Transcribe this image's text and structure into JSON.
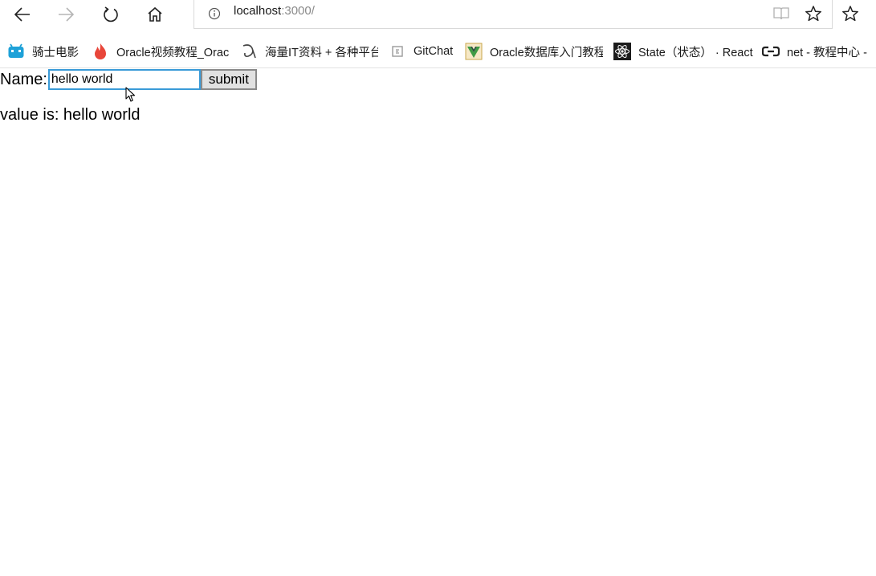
{
  "browser": {
    "address": {
      "host": "localhost",
      "port": ":3000/"
    },
    "toolbar_icons": [
      "back-icon",
      "forward-icon",
      "refresh-icon",
      "home-icon",
      "info-icon",
      "reading-view-icon",
      "favorite-star-icon",
      "favorites-list-icon"
    ],
    "bookmarks": [
      {
        "label": "骑士电影",
        "icon": "bilibili-tv-icon"
      },
      {
        "label": "Oracle视频教程_Orac",
        "icon": "flame-icon"
      },
      {
        "label": "海量IT资料 + 各种平台",
        "icon": "swirl-logo-icon"
      },
      {
        "label": "GitChat",
        "icon": "gitchat-icon"
      },
      {
        "label": "Oracle数据库入门教程",
        "icon": "vue-logo-icon"
      },
      {
        "label": "State（状态） · React",
        "icon": "react-atom-icon"
      },
      {
        "label": "net - 教程中心 - ",
        "icon": "link-icon"
      }
    ],
    "accent_color": "#3a9bd8"
  },
  "page": {
    "form": {
      "label": "Name:",
      "input_value": "hello world",
      "submit_label": "submit"
    },
    "output": "value is: hello world"
  }
}
